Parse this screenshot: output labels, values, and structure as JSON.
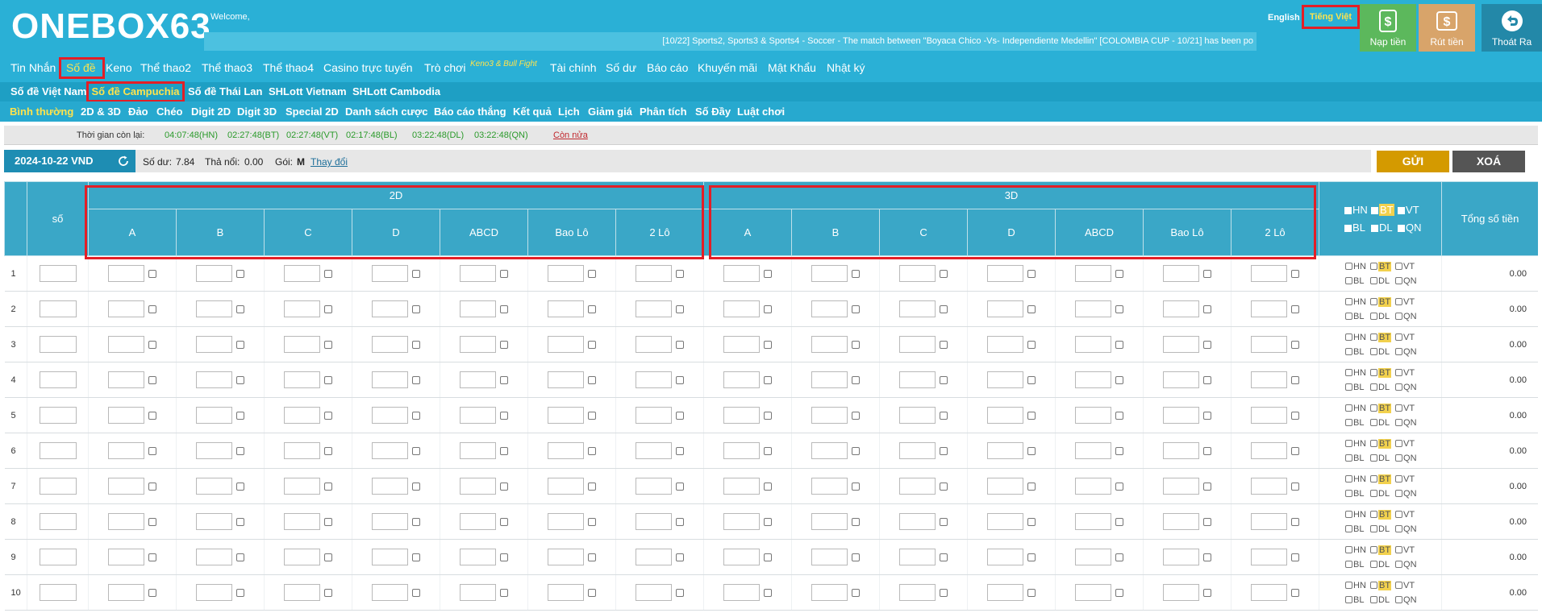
{
  "header": {
    "logo": "ONEBOX63",
    "welcome": "Welcome,",
    "ticker": "[10/22] Sports2, Sports3 & Sports4 - Soccer - The match between \"Boyaca Chico -Vs- Independiente Medellin\" [COLOMBIA CUP - 10/21] has been po",
    "lang_en": "English",
    "lang_vi": "Tiếng Việt",
    "deposit_label": "Nạp tiền",
    "withdraw_label": "Rút tiền",
    "logout_label": "Thoát Ra"
  },
  "nav_main": [
    "Tin Nhắn",
    "Số đề",
    "Keno",
    "Thể thao2",
    "Thể thao3",
    "Thể thao4",
    "Casino trực tuyến",
    "Trò chơi",
    "Tài chính",
    "Số dư",
    "Báo cáo",
    "Khuyến mãi",
    "Mật Khẩu",
    "Nhật ký"
  ],
  "nav_main_active": "Số đề",
  "nav_main_note": "Keno3 & Bull Fight",
  "nav_sub": [
    "Số đề Việt Nam",
    "Số đề Campuchia",
    "Số đề Thái Lan",
    "SHLott Vietnam",
    "SHLott Cambodia"
  ],
  "nav_sub_active": "Số đề Campuchia",
  "nav_tabs": [
    "Bình thường",
    "2D & 3D",
    "Đảo",
    "Chéo",
    "Digit 2D",
    "Digit 3D",
    "Special 2D",
    "Danh sách cược",
    "Báo cáo thắng",
    "Kết quả",
    "Lịch",
    "Giảm giá",
    "Phân tích",
    "Số Đầy",
    "Luật chơi"
  ],
  "nav_tabs_active": "Bình thường",
  "timer": {
    "label": "Thời gian còn lại:",
    "items": [
      "04:07:48(HN)",
      "02:27:48(BT)",
      "02:27:48(VT)",
      "02:17:48(BL)",
      "03:22:48(DL)",
      "03:22:48(QN)"
    ],
    "more": "Còn nửa"
  },
  "info": {
    "date": "2024-10-22 VND",
    "balance_label": "Số dư:",
    "balance": "7.84",
    "float_label": "Thả nổi:",
    "float": "0.00",
    "package_label": "Gói:",
    "package": "M",
    "change_link": "Thay đổi"
  },
  "actions": {
    "send": "GỬI",
    "clear": "XOÁ"
  },
  "table": {
    "col_so": "số",
    "group_2d": "2D",
    "group_3d": "3D",
    "sub_cols": [
      "A",
      "B",
      "C",
      "D",
      "ABCD",
      "Bao Lô",
      "2 Lô"
    ],
    "provinces_top": [
      "HN",
      "BT",
      "VT"
    ],
    "provinces_bottom": [
      "BL",
      "DL",
      "QN"
    ],
    "highlight_province": "BT",
    "col_total": "Tổng số tiền",
    "rows": [
      {
        "idx": "1",
        "total": "0.00"
      },
      {
        "idx": "2",
        "total": "0.00"
      },
      {
        "idx": "3",
        "total": "0.00"
      },
      {
        "idx": "4",
        "total": "0.00"
      },
      {
        "idx": "5",
        "total": "0.00"
      },
      {
        "idx": "6",
        "total": "0.00"
      },
      {
        "idx": "7",
        "total": "0.00"
      },
      {
        "idx": "8",
        "total": "0.00"
      },
      {
        "idx": "9",
        "total": "0.00"
      },
      {
        "idx": "10",
        "total": "0.00"
      }
    ]
  },
  "colors": {
    "header_bg": "#2ab0d6",
    "table_header_bg": "#3aa7c7",
    "active_text": "#ffe34c",
    "annotation_red": "#e41e26",
    "send_button": "#d49a00",
    "clear_button": "#555555",
    "timer_green": "#2a9a2a"
  },
  "icons": {
    "deposit": "dollar-icon",
    "withdraw": "dollar-icon",
    "logout": "back-arrow-icon",
    "refresh": "refresh-icon"
  }
}
